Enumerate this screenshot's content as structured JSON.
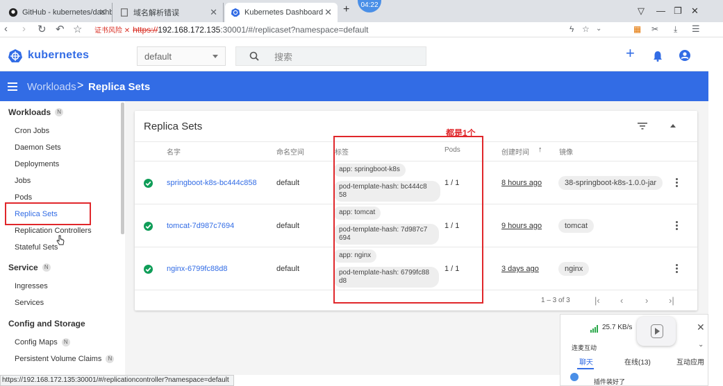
{
  "browser": {
    "tabs": [
      {
        "title": "GitHub - kubernetes/dashb",
        "icon": "github-icon"
      },
      {
        "title": "域名解析错误",
        "icon": "page-icon"
      },
      {
        "title": "Kubernetes Dashboard",
        "icon": "kubernetes-icon",
        "active": true
      }
    ],
    "clock": "04:22",
    "url": {
      "warning": "证书风险",
      "warn_x": "✕",
      "scheme": "https://",
      "host": "192.168.172.135",
      "rest": ":30001/#/replicaset?namespace=default"
    },
    "status_url": "https://192.168.172.135:30001/#/replicationcontroller?namespace=default"
  },
  "header": {
    "logo_text": "kubernetes",
    "namespace": "default",
    "search_placeholder": "搜索"
  },
  "toolbar": {
    "crumb_parent": "Workloads",
    "crumb_separator": ">",
    "crumb_current": "Replica Sets"
  },
  "sidebar": {
    "workloads": {
      "label": "Workloads",
      "badge": "N"
    },
    "items": [
      "Cron Jobs",
      "Daemon Sets",
      "Deployments",
      "Jobs",
      "Pods",
      "Replica Sets",
      "Replication Controllers",
      "Stateful Sets"
    ],
    "service": {
      "label": "Service",
      "badge": "N"
    },
    "service_items": [
      "Ingresses",
      "Services"
    ],
    "config": {
      "label": "Config and Storage"
    },
    "config_items": [
      {
        "label": "Config Maps",
        "badge": "N"
      },
      {
        "label": "Persistent Volume Claims",
        "badge": "N"
      }
    ]
  },
  "card": {
    "title": "Replica Sets",
    "columns": {
      "name": "名字",
      "namespace": "命名空间",
      "labels": "标签",
      "pods": "Pods",
      "created": "创建时间",
      "images": "镜像"
    },
    "rows": [
      {
        "name": "springboot-k8s-bc444c858",
        "namespace": "default",
        "label1": "app: springboot-k8s",
        "label2a": "pod-template-hash: bc444c8",
        "label2b": "58",
        "pods": "1 / 1",
        "created": "8 hours ago",
        "image": "38-springboot-k8s-1.0.0-jar"
      },
      {
        "name": "tomcat-7d987c7694",
        "namespace": "default",
        "label1": "app: tomcat",
        "label2a": "pod-template-hash: 7d987c7",
        "label2b": "694",
        "pods": "1 / 1",
        "created": "9 hours ago",
        "image": "tomcat"
      },
      {
        "name": "nginx-6799fc88d8",
        "namespace": "default",
        "label1": "app: nginx",
        "label2a": "pod-template-hash: 6799fc88",
        "label2b": "d8",
        "pods": "1 / 1",
        "created": "3 days ago",
        "image": "nginx"
      }
    ],
    "pagination": "1 – 3 of 3"
  },
  "annotation": {
    "text": "都是1个"
  },
  "chat": {
    "speed": "25.7 KB/s",
    "live": "连麦互动",
    "tabs": [
      "聊天",
      "在线(13)",
      "互动应用"
    ],
    "message": "插件装好了"
  },
  "colors": {
    "brand": "#326ce5",
    "ok": "#0f9d58",
    "annotation": "#e0262a"
  }
}
